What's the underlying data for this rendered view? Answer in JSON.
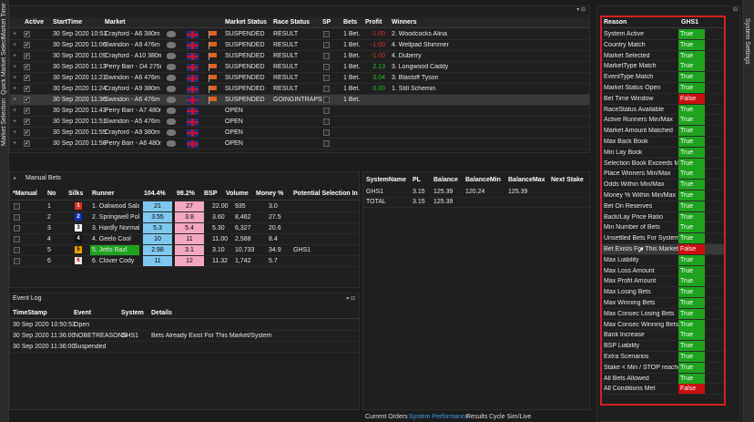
{
  "side_tabs": {
    "market_time": "Market Time",
    "quick_market_select": "Quick Market Select",
    "market_selection": "Market Selection",
    "system_settings": "System Settings"
  },
  "markets": {
    "columns": [
      "Active",
      "StartTime",
      "Market",
      "Market Status",
      "Race Status",
      "SP",
      "Bets",
      "Profit",
      "Winners"
    ],
    "rows": [
      {
        "start": "30 Sep 2020 10:53",
        "market": "Crayford - A6 380m",
        "status": "SUSPENDED",
        "race": "RESULT",
        "bets": "1 Bet.",
        "profit": "-1.00",
        "winners": "2. Woodcocks Alina",
        "pc": "#e03030"
      },
      {
        "start": "30 Sep 2020 11:06",
        "market": "Swindon - A9 476m",
        "status": "SUSPENDED",
        "race": "RESULT",
        "bets": "1 Bet.",
        "profit": "-1.00",
        "winners": "4. Wellpad Shimmer",
        "pc": "#e03030"
      },
      {
        "start": "30 Sep 2020 11:09",
        "market": "Crayford - A10 380m",
        "status": "SUSPENDED",
        "race": "RESULT",
        "bets": "1 Bet.",
        "profit": "-1.00",
        "winners": "4. Duberry",
        "pc": "#e03030"
      },
      {
        "start": "30 Sep 2020 11:13",
        "market": "Perry Barr - D4 275m",
        "status": "SUSPENDED",
        "race": "RESULT",
        "bets": "1 Bet.",
        "profit": "2.13",
        "winners": "3. Longwood Caddy",
        "pc": "#22c022"
      },
      {
        "start": "30 Sep 2020 11:21",
        "market": "Swindon - A6 476m",
        "status": "SUSPENDED",
        "race": "RESULT",
        "bets": "1 Bet.",
        "profit": "3.04",
        "winners": "3. Blastoff Tyson",
        "pc": "#22c022"
      },
      {
        "start": "30 Sep 2020 11:24",
        "market": "Crayford - A9 380m",
        "status": "SUSPENDED",
        "race": "RESULT",
        "bets": "1 Bet.",
        "profit": "0.00",
        "winners": "1. Still Schemin",
        "pc": "#22c022"
      },
      {
        "start": "30 Sep 2020 11:36",
        "market": "Swindon - A6 476m",
        "status": "SUSPENDED",
        "race": "GOINGINTRAPS",
        "bets": "1 Bet.",
        "profit": "",
        "winners": "",
        "pc": "#fff"
      },
      {
        "start": "30 Sep 2020 11:43",
        "market": "Perry Barr - A7 480m",
        "status": "OPEN",
        "race": "",
        "bets": "",
        "profit": "",
        "winners": "",
        "pc": "#fff"
      },
      {
        "start": "30 Sep 2020 11:51",
        "market": "Swindon - A5 476m",
        "status": "OPEN",
        "race": "",
        "bets": "",
        "profit": "",
        "winners": "",
        "pc": "#fff"
      },
      {
        "start": "30 Sep 2020 11:55",
        "market": "Crayford - A9 380m",
        "status": "OPEN",
        "race": "",
        "bets": "",
        "profit": "",
        "winners": "",
        "pc": "#fff"
      },
      {
        "start": "30 Sep 2020 11:58",
        "market": "Perry Barr - A6 480m",
        "status": "OPEN",
        "race": "",
        "bets": "",
        "profit": "",
        "winners": "",
        "pc": "#fff"
      }
    ]
  },
  "manual_bets": {
    "title": "Manual Bets",
    "columns": [
      "*Manual",
      "No",
      "Silks",
      "Runner",
      "104.4%",
      "98.2%",
      "BSP",
      "Volume",
      "Money %",
      "Potential Selection In"
    ],
    "rows": [
      {
        "no": "1",
        "runner": "1. Oakwood Salah",
        "back": "21",
        "lay": "27",
        "bsp": "22.00",
        "vol": "935",
        "money": "3.0",
        "pot": "",
        "silk": "#e03020",
        "sc": "#fff",
        "hl": false
      },
      {
        "no": "2",
        "runner": "2. Springwell Polly",
        "back": "3.55",
        "lay": "3.8",
        "bsp": "3.60",
        "vol": "8,462",
        "money": "27.5",
        "pot": "",
        "silk": "#1030c0",
        "sc": "#fff",
        "hl": false
      },
      {
        "no": "3",
        "runner": "3. Hardly Normal",
        "back": "5.3",
        "lay": "5.4",
        "bsp": "5.30",
        "vol": "6,327",
        "money": "20.6",
        "pot": "",
        "silk": "#ffffff",
        "sc": "#000",
        "hl": false
      },
      {
        "no": "4",
        "runner": "4. Geelo Cool",
        "back": "10",
        "lay": "11",
        "bsp": "11.00",
        "vol": "2,588",
        "money": "8.4",
        "pot": "",
        "silk": "#111111",
        "sc": "#fff",
        "hl": false
      },
      {
        "no": "5",
        "runner": "5. Jetts Razl",
        "back": "2.98",
        "lay": "3.1",
        "bsp": "3.10",
        "vol": "10,733",
        "money": "34.9",
        "pot": "GHS1",
        "silk": "#f0a000",
        "sc": "#000",
        "hl": true
      },
      {
        "no": "6",
        "runner": "6. Clover Cody",
        "back": "11",
        "lay": "12",
        "bsp": "11.32",
        "vol": "1,742",
        "money": "5.7",
        "pot": "",
        "silk": "#e8e8e8",
        "sc": "#c00",
        "hl": false
      }
    ]
  },
  "systems": {
    "columns": [
      "SystemName",
      "PL",
      "Balance",
      "BalanceMin",
      "BalanceMax",
      "Next Stake"
    ],
    "rows": [
      {
        "name": "GHS1",
        "pl": "3.15",
        "bal": "125.39",
        "min": "120.24",
        "max": "125.39",
        "next": ""
      },
      {
        "name": "TOTAL",
        "pl": "3.15",
        "bal": "125.39",
        "min": "",
        "max": "",
        "next": ""
      }
    ]
  },
  "event_log": {
    "title": "Event Log",
    "columns": [
      "TimeStamp",
      "Event",
      "System",
      "Details"
    ],
    "rows": [
      {
        "ts": "30 Sep 2020 10:50:53",
        "ev": "Open",
        "sys": "",
        "det": ""
      },
      {
        "ts": "30 Sep 2020 11:36:00",
        "ev": "NOBETREASONS",
        "sys": "GHS1",
        "det": "Bets Already Exist For This Market/System"
      },
      {
        "ts": "30 Sep 2020 11:36:00",
        "ev": "Suspended",
        "sys": "",
        "det": ""
      }
    ]
  },
  "bottom_tabs": [
    "Current Orders",
    "System Performance",
    "Results",
    "Cycle Sim/Live"
  ],
  "reasons": {
    "columns": [
      "Reason",
      "GHS1"
    ],
    "rows": [
      {
        "r": "System Active",
        "v": "True"
      },
      {
        "r": "Country Match",
        "v": "True"
      },
      {
        "r": "Market Selected",
        "v": "True"
      },
      {
        "r": "MarketType Match",
        "v": "True"
      },
      {
        "r": "EventType Match",
        "v": "True"
      },
      {
        "r": "Market Status Open",
        "v": "True"
      },
      {
        "r": "Bet Time Window",
        "v": "False"
      },
      {
        "r": "RaceStatus Available",
        "v": "True"
      },
      {
        "r": "Active Runners Min/Max",
        "v": "True"
      },
      {
        "r": "Market Amount Matched",
        "v": "True"
      },
      {
        "r": "Max Back Book",
        "v": "True"
      },
      {
        "r": "Min Lay Book",
        "v": "True"
      },
      {
        "r": "Selection Book Exceeds Max",
        "v": "True"
      },
      {
        "r": "Place Winners Min/Max",
        "v": "True"
      },
      {
        "r": "Odds Within Min/Max",
        "v": "True"
      },
      {
        "r": "Money % Within Min/Max",
        "v": "True"
      },
      {
        "r": "Bet On Reserves",
        "v": "True"
      },
      {
        "r": "Back/Lay Price Ratio",
        "v": "True"
      },
      {
        "r": "Min Number of Bets",
        "v": "True"
      },
      {
        "r": "Unsettled Bets For System",
        "v": "True"
      },
      {
        "r": "Bet Exists For This Market",
        "v": "False"
      },
      {
        "r": "Max Liability",
        "v": "True"
      },
      {
        "r": "Max Loss Amount",
        "v": "True"
      },
      {
        "r": "Max Profit Amount",
        "v": "True"
      },
      {
        "r": "Max Losing Bets",
        "v": "True"
      },
      {
        "r": "Max Winning Bets",
        "v": "True"
      },
      {
        "r": "Max Consec Losing Bets",
        "v": "True"
      },
      {
        "r": "Max Consec Winning Bets",
        "v": "True"
      },
      {
        "r": "Bank Increase",
        "v": "True"
      },
      {
        "r": "BSP Liability",
        "v": "True"
      },
      {
        "r": "Extra Scenarios",
        "v": "True"
      },
      {
        "r": "Stake < Min / STOP reached",
        "v": "True"
      },
      {
        "r": "All Bets Allowed",
        "v": "True"
      },
      {
        "r": "All Conditions Met",
        "v": "False"
      }
    ]
  }
}
